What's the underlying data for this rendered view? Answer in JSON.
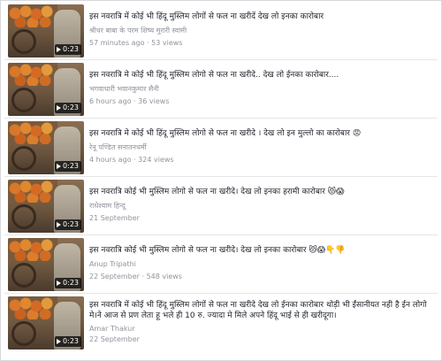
{
  "videos": [
    {
      "title": "इस नवरात्रि में कोई भी हिंदू मुस्लिम लोगों से फल ना खरीदें देख लो इनका कारोबार",
      "author": "श्रीधर बाबा के परम शिष्य मुरारी स्वामी",
      "meta": "57 minutes ago · 53 views",
      "duration": "0:23"
    },
    {
      "title": "इस नवरात्रि मे कोई भी हिंदू मुस्लिम लोगो से फल ना खरीदे.. देख लो ईनका कारोबार....",
      "author": "भगवाधारी भवानकुमार सैनी",
      "meta": "6 hours ago · 36 views",
      "duration": "0:23"
    },
    {
      "title": "इस नवरात्रि मे कोई भी हिंदू मुस्लिम लोगो से फल ना खरीदे । देख लो इन मुल्लो का कारोबार 😡",
      "author": "रेनू पण्डित सनातनधर्मी",
      "meta": "4 hours ago · 324 views",
      "duration": "0:23"
    },
    {
      "title": "इस नवरात्रि कोई भी मुस्लिम लोगो से फल ना खरीदे। देख लो इनका हरामी कारोबार 😾😱",
      "author": "राधेश्याम हिन्दू",
      "meta": "21 September",
      "duration": "0:23"
    },
    {
      "title": "इस नवरात्रि कोई भी मुस्लिम लोगो से फल ना खरीदे। देख लो इनका कारोबार 😾😱👇👎",
      "author": "Anup Tripathi",
      "meta": "22 September · 548 views",
      "duration": "0:23"
    },
    {
      "title": "इस नवरात्रि में कोई भी हिंदू मुस्लिम लोगों से फल ना खरीदे देख लो ईनका कारोबार थोड़ी भी ईंसानीयत नही है ईन लोगो मे।ने आज से प्रण लेता हू भले ही 10 रु. ज्यादा मे मिले अपने हिंदू भाई से ही खरीदूगा।",
      "author": "Amar Thakur",
      "meta": "22 September",
      "duration": "0:23"
    }
  ]
}
